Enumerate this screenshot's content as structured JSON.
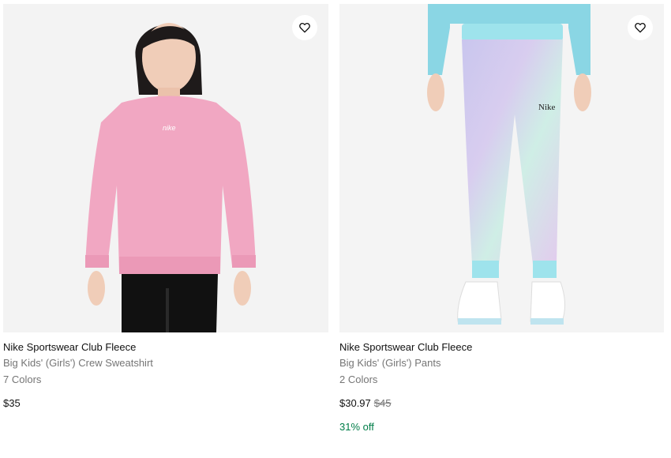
{
  "products": [
    {
      "title": "Nike Sportswear Club Fleece",
      "subtitle": "Big Kids' (Girls') Crew Sweatshirt",
      "colors": "7 Colors",
      "price": "$35",
      "image_icon": "pink-crew-sweatshirt-photo",
      "favorite_icon": "heart-icon"
    },
    {
      "title": "Nike Sportswear Club Fleece",
      "subtitle": "Big Kids' (Girls') Pants",
      "colors": "2 Colors",
      "price": "$30.97",
      "original_price": "$45",
      "discount": "31% off",
      "image_icon": "pastel-fleece-pants-photo",
      "favorite_icon": "heart-icon"
    }
  ],
  "colors": {
    "text": "#111111",
    "muted": "#757575",
    "discount": "#007d48",
    "image_bg": "#f5f5f5"
  }
}
